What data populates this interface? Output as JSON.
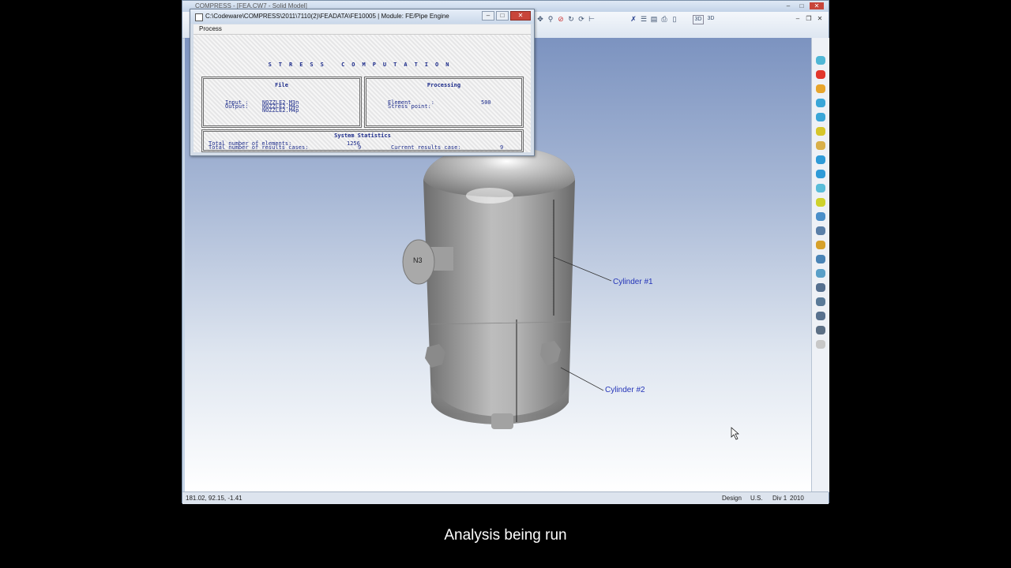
{
  "app": {
    "title": "COMPRESS - [FEA.CW7 - Solid Model]",
    "min": "–",
    "max": "□",
    "close": "✕"
  },
  "mdi": {
    "min": "–",
    "restore": "❐",
    "close": "✕"
  },
  "toolbar_icons": [
    "pan-icon",
    "zoom-icon",
    "no-icon",
    "rotate-icon",
    "refresh-icon",
    "axis-icon",
    "delete-icon",
    "list-icon",
    "print-icon",
    "cylinder-icon",
    "3d-button",
    "3d-alt-button"
  ],
  "toolbar_labels": {
    "three_d": "3D",
    "three_d_alt": "3D"
  },
  "dialog": {
    "title": "C:\\Codeware\\COMPRESS\\2011\\7110(2)\\FEADATA\\FE10005  |  Module: FE/Pipe Engine",
    "menu_process": "Process",
    "heading": "STRESS  COMPUTATION",
    "file_panel": {
      "header": "File",
      "input_label": "Input :",
      "input_value": "NOZZLE2.M3n",
      "output_label": "Output:",
      "output_value_1": "NOZZLE2.M4o",
      "output_value_2": "NOZZLE2.M4p"
    },
    "processing_panel": {
      "header": "Processing",
      "element_label": "Element      :",
      "element_value": "500",
      "stress_point_label": "Stress point:"
    },
    "stats_panel": {
      "header": "System Statistics",
      "total_elements_label": "Total number of elements:",
      "total_elements_value": "1256",
      "total_cases_label": "Total number of results cases:",
      "total_cases_value": "9",
      "current_case_label": "Current results case:",
      "current_case_value": "9"
    }
  },
  "viewport": {
    "nozzle_label": "N3",
    "callout_1": "Cylinder #1",
    "callout_2": "Cylinder #2"
  },
  "status": {
    "coords": "181.02, 92.15, -1.41",
    "mode": "Design",
    "units": "U.S.",
    "division": "Div 1",
    "year": "2010"
  },
  "caption": "Analysis being run",
  "palette_colors": [
    "#4fb7d6",
    "#e2362b",
    "#e8a52c",
    "#3aa6d8",
    "#3aa6d8",
    "#d6c62b",
    "#d9b04a",
    "#2f9bd8",
    "#2f9bd8",
    "#59bdd9",
    "#cfd22c",
    "#4b8fc9",
    "#5a7fa8",
    "#d6a12b",
    "#4a84b6",
    "#5aa0c8",
    "#56708f",
    "#5a7a98",
    "#58718e",
    "#5c6f85",
    "#c8c8c8"
  ]
}
